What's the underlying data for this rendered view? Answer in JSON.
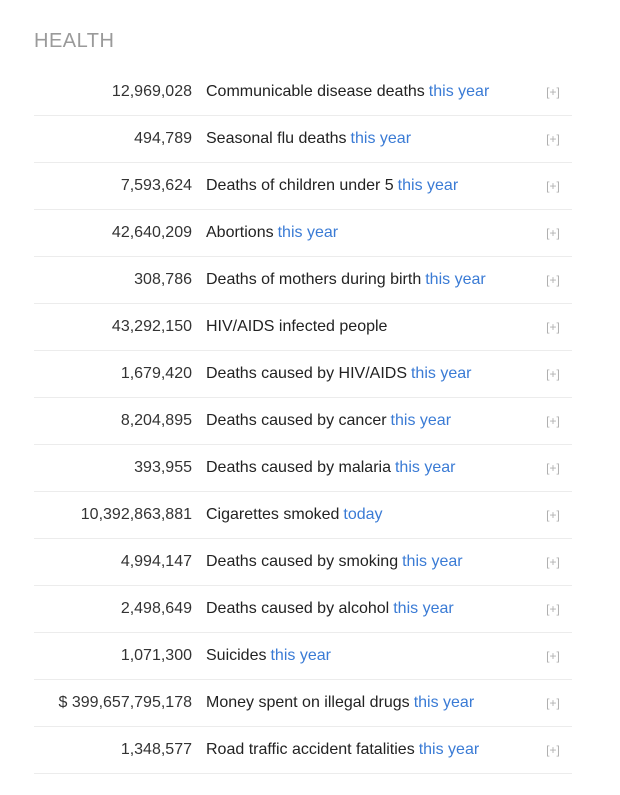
{
  "section": {
    "title": "HEALTH"
  },
  "rows": [
    {
      "count": "12,969,028",
      "label": "Communicable disease deaths",
      "period": "this year",
      "expand": "[+]"
    },
    {
      "count": "494,789",
      "label": "Seasonal flu deaths",
      "period": "this year",
      "expand": "[+]"
    },
    {
      "count": "7,593,624",
      "label": "Deaths of children under 5",
      "period": "this year",
      "expand": "[+]"
    },
    {
      "count": "42,640,209",
      "label": "Abortions",
      "period": "this year",
      "expand": "[+]"
    },
    {
      "count": "308,786",
      "label": "Deaths of mothers during birth",
      "period": "this year",
      "expand": "[+]"
    },
    {
      "count": "43,292,150",
      "label": "HIV/AIDS infected people",
      "period": "",
      "expand": "[+]"
    },
    {
      "count": "1,679,420",
      "label": "Deaths caused by HIV/AIDS",
      "period": "this year",
      "expand": "[+]"
    },
    {
      "count": "8,204,895",
      "label": "Deaths caused by cancer",
      "period": "this year",
      "expand": "[+]"
    },
    {
      "count": "393,955",
      "label": "Deaths caused by malaria",
      "period": "this year",
      "expand": "[+]"
    },
    {
      "count": "10,392,863,881",
      "label": "Cigarettes smoked",
      "period": "today",
      "expand": "[+]"
    },
    {
      "count": "4,994,147",
      "label": "Deaths caused by smoking",
      "period": "this year",
      "expand": "[+]"
    },
    {
      "count": "2,498,649",
      "label": "Deaths caused by alcohol",
      "period": "this year",
      "expand": "[+]"
    },
    {
      "count": "1,071,300",
      "label": "Suicides",
      "period": "this year",
      "expand": "[+]"
    },
    {
      "count": "$ 399,657,795,178",
      "label": "Money spent on illegal drugs",
      "period": "this year",
      "expand": "[+]"
    },
    {
      "count": "1,348,577",
      "label": "Road traffic accident fatalities",
      "period": "this year",
      "expand": "[+]"
    }
  ],
  "colors": {
    "title": "#9a9a9a",
    "link": "#3a7bd5",
    "expand": "#b0b0b0",
    "divider": "#ececec"
  }
}
